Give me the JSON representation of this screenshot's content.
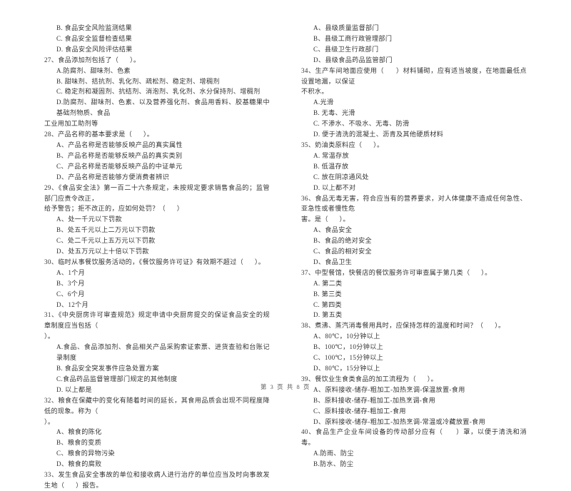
{
  "document": {
    "type": "exam-paper",
    "page_label_prefix": "第",
    "page_number": "3",
    "page_label_middle": "页 共",
    "total_pages": "8",
    "page_label_suffix": "页",
    "footer_text": "第 3 页 共 8 页"
  },
  "left_column": {
    "lines": [
      {
        "kind": "opt",
        "text": "B. 食品安全风险监测结果"
      },
      {
        "kind": "opt",
        "text": "C. 食品安全监督检查结果"
      },
      {
        "kind": "opt",
        "text": "D. 食品安全风险评估结果"
      },
      {
        "kind": "stem",
        "text": "27、食品添加剂包括了（      ）。"
      },
      {
        "kind": "opt",
        "text": "A.防腐剂、甜味剂、色素"
      },
      {
        "kind": "opt",
        "text": "B. 甜味剂、拮抗剂、乳化剂、疏松剂、稳定剂、增稠剂"
      },
      {
        "kind": "opt",
        "text": "C. 稳定剂和凝固剂、抗结剂、消泡剂、乳化剂、水分保持剂、增稠剂"
      },
      {
        "kind": "opt",
        "text": "D.防腐剂、甜味剂、色素、以及营养强化剂、食品用香料、胶基糖果中基础剂物质、食品"
      },
      {
        "kind": "opt-cont",
        "text": "工业用加工助剂等"
      },
      {
        "kind": "stem",
        "text": "28、产品名称的基本要求是（      ）。"
      },
      {
        "kind": "opt",
        "text": "A、产品名称是否能够反映产品的真实属性"
      },
      {
        "kind": "opt",
        "text": "B、产品名称是否能够反映产品的真实类别"
      },
      {
        "kind": "opt",
        "text": "C、产品名称是否能够反映产品的中证单元"
      },
      {
        "kind": "opt",
        "text": "D、产品名称是否能够方便消费者辨识"
      },
      {
        "kind": "stem",
        "text": "29、《食品安全法》第一百二十六条规定，未按规定要求销售食品的；监管部门应责令改正，"
      },
      {
        "kind": "stem-cont",
        "text": "给予警告；拒不改正的，应如何处罚？（      ）"
      },
      {
        "kind": "opt",
        "text": "A、处一千元以下罚款"
      },
      {
        "kind": "opt",
        "text": "B、处五千元以上二万元以下罚款"
      },
      {
        "kind": "opt",
        "text": "C、处二千元以上五万元以下罚款"
      },
      {
        "kind": "opt",
        "text": "D、处五万元以上十倍以下罚款"
      },
      {
        "kind": "stem",
        "text": "30、临时从事餐饮服务活动的，《餐饮服务许可证》有效期不超过（      ）。"
      },
      {
        "kind": "opt",
        "text": "A、1个月"
      },
      {
        "kind": "opt",
        "text": "B、3个月"
      },
      {
        "kind": "opt",
        "text": "C、6个月"
      },
      {
        "kind": "opt",
        "text": "D、12个月"
      },
      {
        "kind": "stem",
        "text": "31、《中央厨房许可审查规范》规定申请中央厨房提交的保证食品安全的规章制度应当包括（"
      },
      {
        "kind": "stem-cont",
        "text": "）。"
      },
      {
        "kind": "opt",
        "text": "A.食品、食品添加剂、食品相关产品采购索证索票、进货查验和台账记录制度"
      },
      {
        "kind": "opt",
        "text": "B. 食品安全突发事件应急处置方案"
      },
      {
        "kind": "opt",
        "text": "C.食品药品监督管理部门规定的其他制度"
      },
      {
        "kind": "opt",
        "text": "D. 以上都是"
      },
      {
        "kind": "stem",
        "text": "32、粮食在保藏中的变化有随着时间的延长，其食用品质会出现不同程度降低的现象。称为（"
      },
      {
        "kind": "stem-cont",
        "text": "）。"
      },
      {
        "kind": "opt",
        "text": "A、粮食的陈化"
      },
      {
        "kind": "opt",
        "text": "B、粮食的变质"
      },
      {
        "kind": "opt",
        "text": "C、粮食的异物污染"
      },
      {
        "kind": "opt",
        "text": "D、粮食的腐败"
      },
      {
        "kind": "stem",
        "text": "33、发生食品安全事故的单位和接收病人进行治疗的单位应当及时向事故发生地（      ）报告。"
      }
    ]
  },
  "right_column": {
    "lines": [
      {
        "kind": "opt",
        "text": "A、县级质量监督部门"
      },
      {
        "kind": "opt",
        "text": "B、县级工商行政管理部门"
      },
      {
        "kind": "opt",
        "text": "C、县级卫生行政部门"
      },
      {
        "kind": "opt",
        "text": "D、县级食品药品监管部门"
      },
      {
        "kind": "stem",
        "text": "34、生产车间地面应使用（      ）材料铺砌，应有适当坡度，在地面最低点设置地漏，以保证"
      },
      {
        "kind": "stem-cont",
        "text": "不积水。"
      },
      {
        "kind": "opt",
        "text": "A.光滑"
      },
      {
        "kind": "opt",
        "text": "B. 无毒、光滑"
      },
      {
        "kind": "opt",
        "text": "C. 不渗水、不吸水、无毒、防滑"
      },
      {
        "kind": "opt",
        "text": "D. 便于清洗的混凝土、沥青及其他硬质材料"
      },
      {
        "kind": "stem",
        "text": "35、奶油类原料应（      ）。"
      },
      {
        "kind": "opt",
        "text": "A. 常温存放"
      },
      {
        "kind": "opt",
        "text": "B. 低温存放"
      },
      {
        "kind": "opt",
        "text": "C. 放在阴凉通风处"
      },
      {
        "kind": "opt",
        "text": "D. 以上都不对"
      },
      {
        "kind": "stem",
        "text": "36、食品无毒无害，符合应当有的营养要求，对人体健康不造成任何急性、亚急性或者慢性危"
      },
      {
        "kind": "stem-cont",
        "text": "害。是（      ）。"
      },
      {
        "kind": "opt",
        "text": "A、食品安全"
      },
      {
        "kind": "opt",
        "text": "B、食品的绝对安全"
      },
      {
        "kind": "opt",
        "text": "C、食品的相对安全"
      },
      {
        "kind": "opt",
        "text": "D、食品卫生"
      },
      {
        "kind": "stem",
        "text": "37、中型餐馆，快餐店的餐饮服务许可审查属于第几类（      ）。"
      },
      {
        "kind": "opt",
        "text": "A. 第二类"
      },
      {
        "kind": "opt",
        "text": "B. 第三类"
      },
      {
        "kind": "opt",
        "text": "C. 第四类"
      },
      {
        "kind": "opt",
        "text": "D. 第五类"
      },
      {
        "kind": "stem",
        "text": "38、煮沸、蒸汽消毒餐用具时，应保持怎样的温度和时间？（      ）。"
      },
      {
        "kind": "opt",
        "text": "A、80℃，10分钟以上"
      },
      {
        "kind": "opt",
        "text": "B、100℃，10分钟以上"
      },
      {
        "kind": "opt",
        "text": "C、100℃，15分钟以上"
      },
      {
        "kind": "opt",
        "text": "D、80℃，15分钟以上"
      },
      {
        "kind": "stem",
        "text": "39、餐饮业生食类食品的加工流程为（      ）。"
      },
      {
        "kind": "opt",
        "text": "A、原料接收-储存-粗加工-加热烹调-保温放置-食用"
      },
      {
        "kind": "opt",
        "text": "B、原料接收-储存-粗加工-加热烹调-食用"
      },
      {
        "kind": "opt",
        "text": "C、原料接收-储存-粗加工-食用"
      },
      {
        "kind": "opt",
        "text": "D、原料接收-储存-粗加工-加热烹调-常温或冷藏放置-食用"
      },
      {
        "kind": "stem",
        "text": "40、食品生产企业车间设备的传动部分应有（      ）罩，以便于清洗和消毒。"
      },
      {
        "kind": "opt",
        "text": "A.防雨、防尘"
      },
      {
        "kind": "opt",
        "text": "B.防水、防尘"
      }
    ]
  }
}
